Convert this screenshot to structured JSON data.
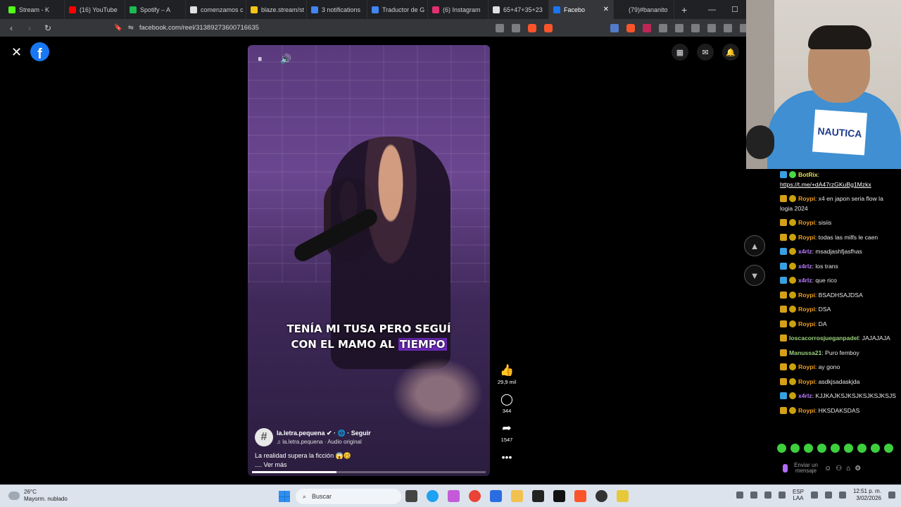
{
  "browser": {
    "tabs": [
      {
        "label": "Stream - K",
        "color": "#53fc18"
      },
      {
        "label": "(16) YouTube",
        "color": "#ff0000"
      },
      {
        "label": "Spotify – A",
        "color": "#1db954"
      },
      {
        "label": "comenzamos c",
        "color": "#e0e0e0"
      },
      {
        "label": "blaze.stream/st",
        "color": "#f5c518"
      },
      {
        "label": "3 notifications",
        "color": "#4285f4"
      },
      {
        "label": "Traductor de G",
        "color": "#4285f4"
      },
      {
        "label": "(6) Instagram",
        "color": "#e1306c"
      },
      {
        "label": "65+47+35+23",
        "color": "#e0e0e0"
      },
      {
        "label": "Facebo",
        "color": "#1877f2"
      },
      {
        "label": "(79)#bananito",
        "color": "#222222"
      }
    ],
    "active_tab_index": 9,
    "new_tab": "+",
    "url": "facebook.com/reel/3138927360071​6635"
  },
  "facebook": {
    "logo": "f",
    "close": "✕",
    "top_icons": [
      "menu-grid-icon",
      "messenger-icon",
      "bell-icon"
    ],
    "caption_line1": "TENÍA MI TUSA PERO SEGUÍ",
    "caption_line2_a": "CON EL MAMO AL ",
    "caption_line2_b": "TIEMPO",
    "channel_avatar": "#",
    "channel_name": "la.letra.pequena ✔ · 🌐 · Seguir",
    "audio": "♫ la.letra.pequena · Audio original",
    "description": "La realidad supera la ficción 😱🥴",
    "see_more": ".... Ver más",
    "progress": 0.36,
    "likes": "29,9 mil",
    "comments": "344",
    "shares": "1547",
    "more": "•••"
  },
  "chat": {
    "messages": [
      {
        "user": "BotRix",
        "color": "#e9e34a",
        "badges": [
          "blue",
          "green"
        ],
        "text": "",
        "link": "https://t.me/+dA47rzGKuBg1Mzkx"
      },
      {
        "user": "Roypi",
        "color": "#f0a020",
        "badges": [
          "king",
          "circle"
        ],
        "text": "x4 en japon seria flow la logia 2024"
      },
      {
        "user": "Roypi",
        "color": "#f0a020",
        "badges": [
          "king",
          "circle"
        ],
        "text": "sisiis"
      },
      {
        "user": "Roypi",
        "color": "#f0a020",
        "badges": [
          "king",
          "circle"
        ],
        "text": "todas las milfs le caen"
      },
      {
        "user": "x4rlz",
        "color": "#b97cff",
        "badges": [
          "blue",
          "circle"
        ],
        "text": "msadjashfjasfhas"
      },
      {
        "user": "x4rlz",
        "color": "#b97cff",
        "badges": [
          "blue",
          "circle"
        ],
        "text": "los trans"
      },
      {
        "user": "x4rlz",
        "color": "#b97cff",
        "badges": [
          "blue",
          "circle"
        ],
        "text": "que rico"
      },
      {
        "user": "Roypi",
        "color": "#f0a020",
        "badges": [
          "king",
          "circle"
        ],
        "text": "BSADHSAJDSA"
      },
      {
        "user": "Roypi",
        "color": "#f0a020",
        "badges": [
          "king",
          "circle"
        ],
        "text": "DSA"
      },
      {
        "user": "Roypi",
        "color": "#f0a020",
        "badges": [
          "king",
          "circle"
        ],
        "text": "DA"
      },
      {
        "user": "loscacorrosjueganpadel",
        "color": "#9ad27c",
        "badges": [
          "king"
        ],
        "text": "JAJAJAJA"
      },
      {
        "user": "Manussa21",
        "color": "#9ad27c",
        "badges": [
          "king"
        ],
        "text": "Puro femboy"
      },
      {
        "user": "Roypi",
        "color": "#f0a020",
        "badges": [
          "king",
          "circle"
        ],
        "text": "ay gono"
      },
      {
        "user": "Roypi",
        "color": "#f0a020",
        "badges": [
          "king",
          "circle"
        ],
        "text": "asdkjsadaskjda"
      },
      {
        "user": "x4rlz",
        "color": "#b97cff",
        "badges": [
          "blue",
          "circle"
        ],
        "text": "KJJKAJKSJKSJKSJKSJKSJS"
      },
      {
        "user": "Roypi",
        "color": "#f0a020",
        "badges": [
          "king",
          "circle"
        ],
        "text": "HKSDAKSDAS"
      }
    ],
    "input_placeholder": "Enviar un mensaje"
  },
  "taskbar": {
    "temp": "26°C",
    "weather": "Mayorm. nublado",
    "search": "Buscar",
    "lang1": "ESP",
    "lang2": "LAA",
    "time": "12:51 p. m.",
    "date": "3/02/2026"
  }
}
